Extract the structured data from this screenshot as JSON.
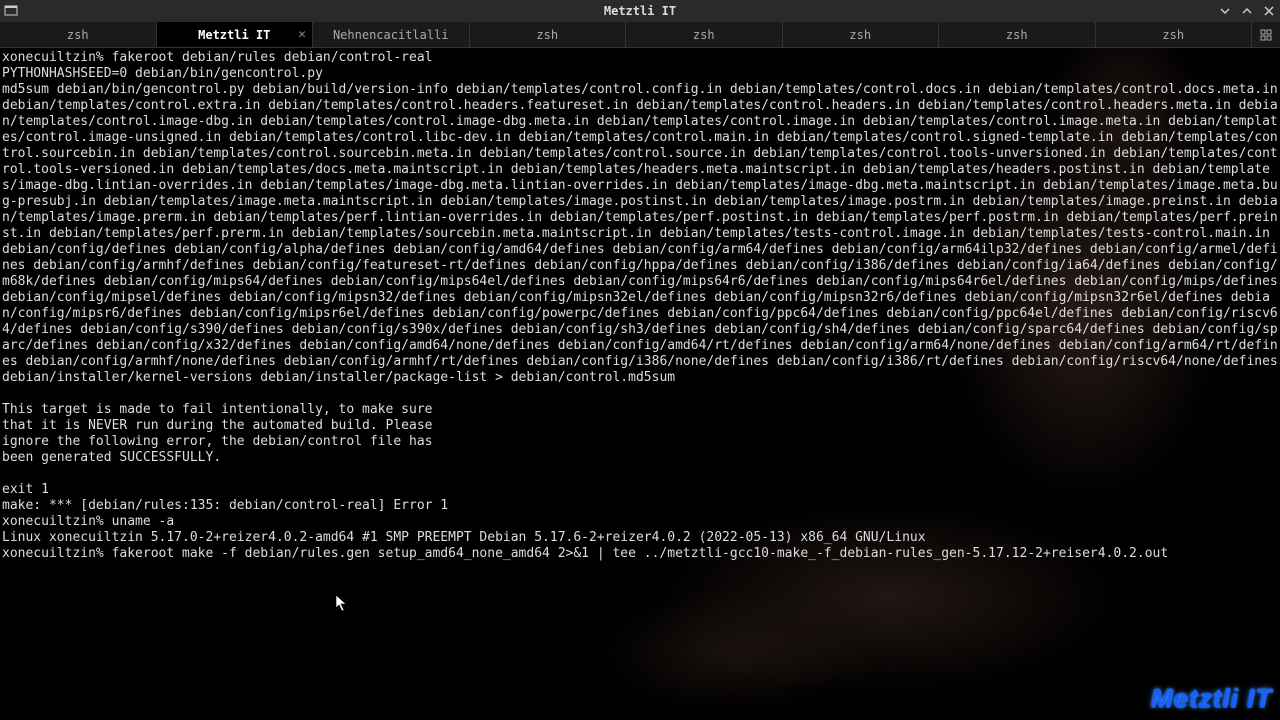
{
  "window": {
    "title": "Metztli IT",
    "icon": "🖥"
  },
  "tabs": [
    {
      "label": "zsh",
      "active": false
    },
    {
      "label": "Metztli IT",
      "active": true,
      "closable": true
    },
    {
      "label": "Nehnencacitlalli",
      "active": false
    },
    {
      "label": "zsh",
      "active": false
    },
    {
      "label": "zsh",
      "active": false
    },
    {
      "label": "zsh",
      "active": false
    },
    {
      "label": "zsh",
      "active": false
    },
    {
      "label": "zsh",
      "active": false
    }
  ],
  "watermark": "Metztli IT",
  "terminal_lines": [
    "xonecuiltzin% fakeroot debian/rules debian/control-real",
    "PYTHONHASHSEED=0 debian/bin/gencontrol.py",
    "md5sum debian/bin/gencontrol.py debian/build/version-info debian/templates/control.config.in debian/templates/control.docs.in debian/templates/control.docs.meta.in debian/templates/control.extra.in debian/templates/control.headers.featureset.in debian/templates/control.headers.in debian/templates/control.headers.meta.in debian/templates/control.image-dbg.in debian/templates/control.image-dbg.meta.in debian/templates/control.image.in debian/templates/control.image.meta.in debian/templates/control.image-unsigned.in debian/templates/control.libc-dev.in debian/templates/control.main.in debian/templates/control.signed-template.in debian/templates/control.sourcebin.in debian/templates/control.sourcebin.meta.in debian/templates/control.source.in debian/templates/control.tools-unversioned.in debian/templates/control.tools-versioned.in debian/templates/docs.meta.maintscript.in debian/templates/headers.meta.maintscript.in debian/templates/headers.postinst.in debian/templates/image-dbg.lintian-overrides.in debian/templates/image-dbg.meta.lintian-overrides.in debian/templates/image-dbg.meta.maintscript.in debian/templates/image.meta.bug-presubj.in debian/templates/image.meta.maintscript.in debian/templates/image.postinst.in debian/templates/image.postrm.in debian/templates/image.preinst.in debian/templates/image.prerm.in debian/templates/perf.lintian-overrides.in debian/templates/perf.postinst.in debian/templates/perf.postrm.in debian/templates/perf.preinst.in debian/templates/perf.prerm.in debian/templates/sourcebin.meta.maintscript.in debian/templates/tests-control.image.in debian/templates/tests-control.main.in debian/config/defines debian/config/alpha/defines debian/config/amd64/defines debian/config/arm64/defines debian/config/arm64ilp32/defines debian/config/armel/defines debian/config/armhf/defines debian/config/featureset-rt/defines debian/config/hppa/defines debian/config/i386/defines debian/config/ia64/defines debian/config/m68k/defines debian/config/mips64/defines debian/config/mips64el/defines debian/config/mips64r6/defines debian/config/mips64r6el/defines debian/config/mips/defines debian/config/mipsel/defines debian/config/mipsn32/defines debian/config/mipsn32el/defines debian/config/mipsn32r6/defines debian/config/mipsn32r6el/defines debian/config/mipsr6/defines debian/config/mipsr6el/defines debian/config/powerpc/defines debian/config/ppc64/defines debian/config/ppc64el/defines debian/config/riscv64/defines debian/config/s390/defines debian/config/s390x/defines debian/config/sh3/defines debian/config/sh4/defines debian/config/sparc64/defines debian/config/sparc/defines debian/config/x32/defines debian/config/amd64/none/defines debian/config/amd64/rt/defines debian/config/arm64/none/defines debian/config/arm64/rt/defines debian/config/armhf/none/defines debian/config/armhf/rt/defines debian/config/i386/none/defines debian/config/i386/rt/defines debian/config/riscv64/none/defines debian/installer/kernel-versions debian/installer/package-list > debian/control.md5sum",
    "",
    "This target is made to fail intentionally, to make sure",
    "that it is NEVER run during the automated build. Please",
    "ignore the following error, the debian/control file has",
    "been generated SUCCESSFULLY.",
    "",
    "exit 1",
    "make: *** [debian/rules:135: debian/control-real] Error 1",
    "xonecuiltzin% uname -a",
    "Linux xonecuiltzin 5.17.0-2+reizer4.0.2-amd64 #1 SMP PREEMPT Debian 5.17.6-2+reizer4.0.2 (2022-05-13) x86_64 GNU/Linux",
    "xonecuiltzin% fakeroot make -f debian/rules.gen setup_amd64_none_amd64 2>&1 | tee ../metztli-gcc10-make_-f_debian-rules_gen-5.17.12-2+reiser4.0.2.out"
  ]
}
